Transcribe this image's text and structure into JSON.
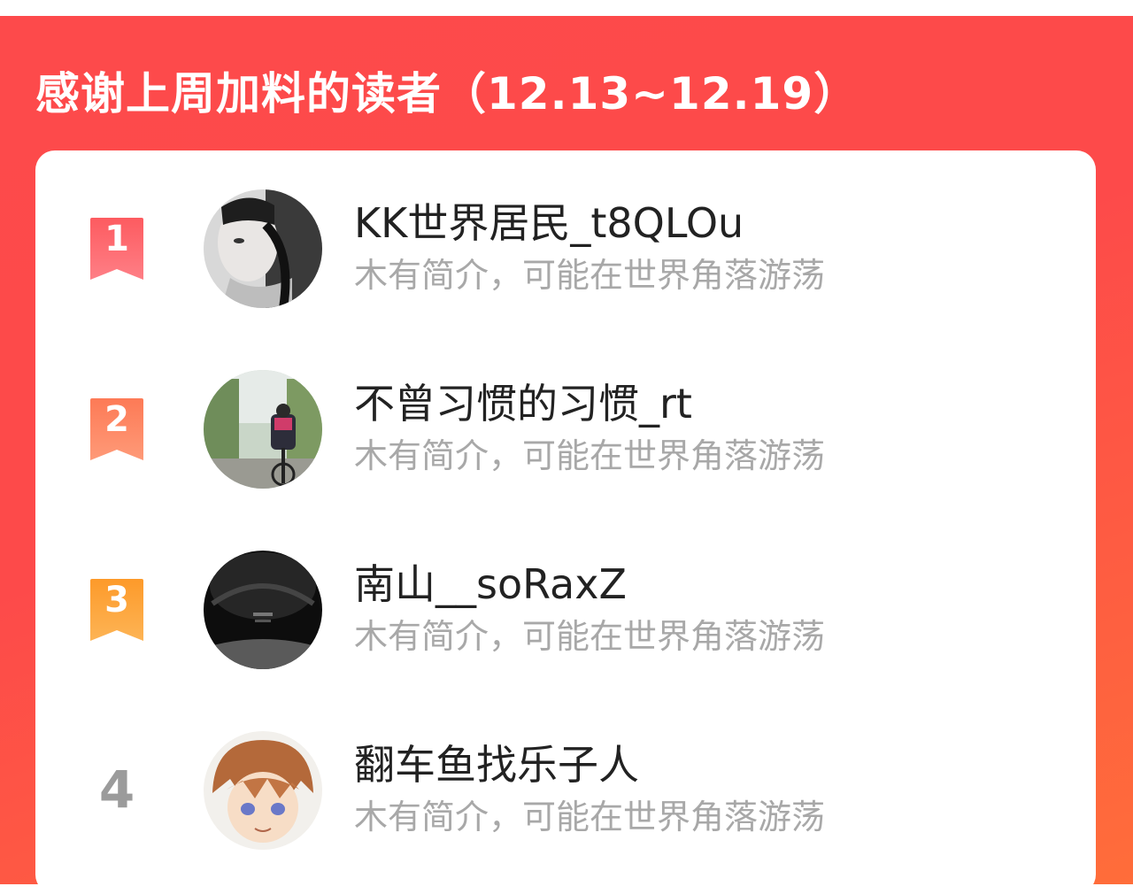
{
  "header": {
    "title": "感谢上周加料的读者（12.13~12.19）"
  },
  "colors": {
    "banner": "#fd4a4a",
    "banner_end": "#ff6d3a",
    "rank1": "#fd5b60",
    "rank2": "#fd7a56",
    "rank3": "#fda23a",
    "rank_plain": "#9b9b9b"
  },
  "readers": [
    {
      "rank": "1",
      "name": "KK世界居民_t8QLOu",
      "bio": "木有简介，可能在世界角落游荡"
    },
    {
      "rank": "2",
      "name": "不曾习惯的习惯_rt",
      "bio": "木有简介，可能在世界角落游荡"
    },
    {
      "rank": "3",
      "name": "南山__soRaxZ",
      "bio": "木有简介，可能在世界角落游荡"
    },
    {
      "rank": "4",
      "name": "翻车鱼找乐子人",
      "bio": "木有简介，可能在世界角落游荡"
    }
  ]
}
